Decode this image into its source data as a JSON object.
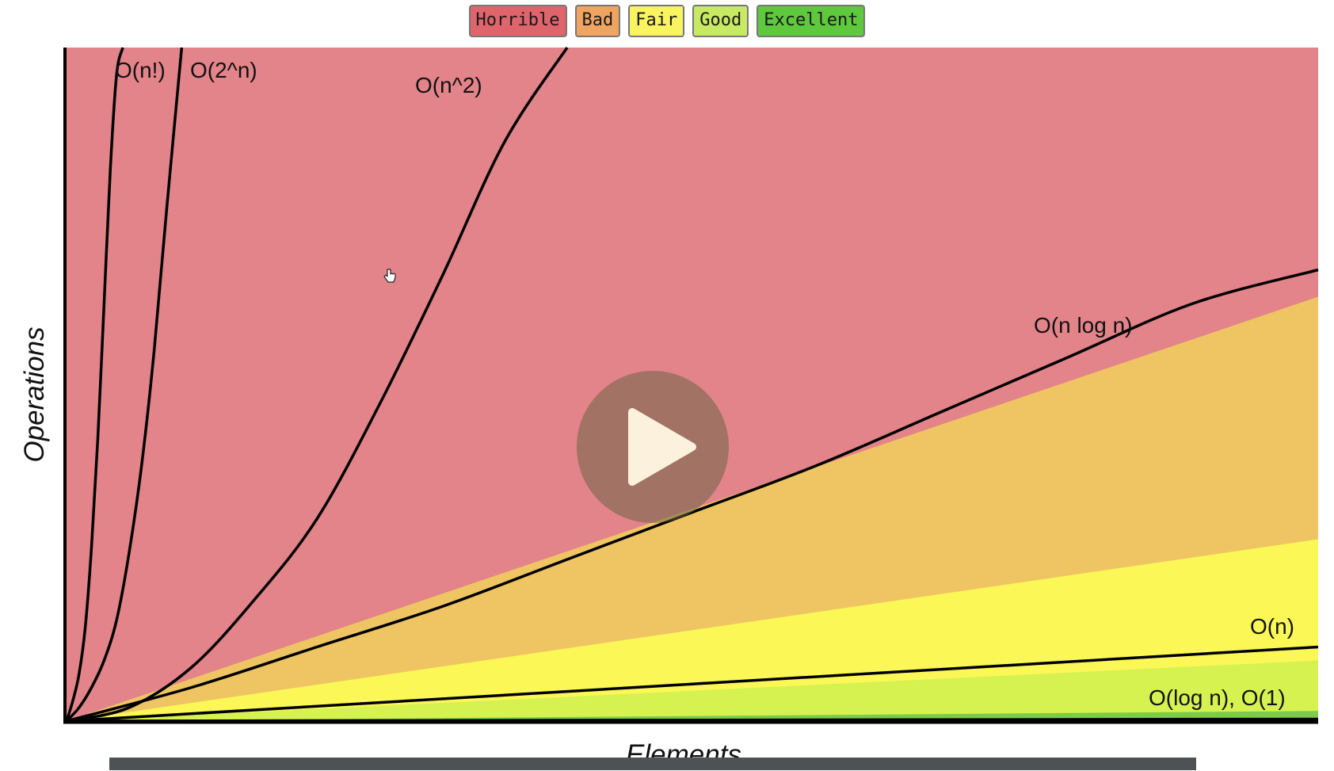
{
  "legend": [
    {
      "label": "Horrible",
      "color": "#df646b"
    },
    {
      "label": "Bad",
      "color": "#efa460"
    },
    {
      "label": "Fair",
      "color": "#f9f460"
    },
    {
      "label": "Good",
      "color": "#c8ea62"
    },
    {
      "label": "Excellent",
      "color": "#5ec93c"
    }
  ],
  "colors": {
    "horrible_area": "#e2848a",
    "bad_area": "#eec562",
    "fair_area": "#fbf756",
    "good_area": "#d6f250",
    "excellent_area": "#7ccb4a"
  },
  "chart_data": {
    "type": "line",
    "title": "",
    "xlabel": "Elements",
    "ylabel": "Operations",
    "xlim": [
      0,
      100
    ],
    "ylim": [
      0,
      100
    ],
    "regions": [
      {
        "name": "Horrible",
        "upper_bound_slope": null
      },
      {
        "name": "Bad",
        "upper_bound_slope": 0.63
      },
      {
        "name": "Fair",
        "upper_bound_slope": 0.27
      },
      {
        "name": "Good",
        "upper_bound_slope": 0.09
      },
      {
        "name": "Excellent",
        "upper_bound_slope": 0.015
      }
    ],
    "series": [
      {
        "name": "O(n!)",
        "x": [
          0,
          0.5,
          1,
          1.5,
          2,
          2.5,
          3,
          3.5,
          4,
          4.5
        ],
        "y": [
          0,
          3,
          7,
          14,
          26,
          42,
          62,
          82,
          96,
          100
        ]
      },
      {
        "name": "O(2^n)",
        "x": [
          0,
          1,
          2,
          3,
          4,
          5,
          6,
          7,
          8,
          9.2
        ],
        "y": [
          0,
          2,
          5,
          9,
          15,
          25,
          38,
          55,
          76,
          100
        ]
      },
      {
        "name": "O(n^2)",
        "x": [
          0,
          5,
          10,
          15,
          20,
          25,
          30,
          35,
          40
        ],
        "y": [
          0,
          2,
          8,
          18,
          30,
          47,
          66,
          86,
          100
        ]
      },
      {
        "name": "O(n log n)",
        "x": [
          0,
          10,
          20,
          30,
          40,
          50,
          60,
          70,
          80,
          90,
          100
        ],
        "y": [
          0,
          5,
          11,
          17,
          24,
          31,
          38,
          46,
          54,
          62,
          67
        ]
      },
      {
        "name": "O(n)",
        "x": [
          0,
          100
        ],
        "y": [
          0,
          11
        ]
      },
      {
        "name": "O(log n), O(1)",
        "x": [
          0,
          100
        ],
        "y": [
          0,
          0.3
        ]
      }
    ]
  },
  "labels": {
    "on_fact": "O(n!)",
    "o2n": "O(2^n)",
    "on2": "O(n^2)",
    "onlogn": "O(n log n)",
    "on": "O(n)",
    "ologn": "O(log n), O(1)"
  },
  "player": {
    "play_icon": "play-icon",
    "cursor_icon": "hand-cursor-icon"
  }
}
